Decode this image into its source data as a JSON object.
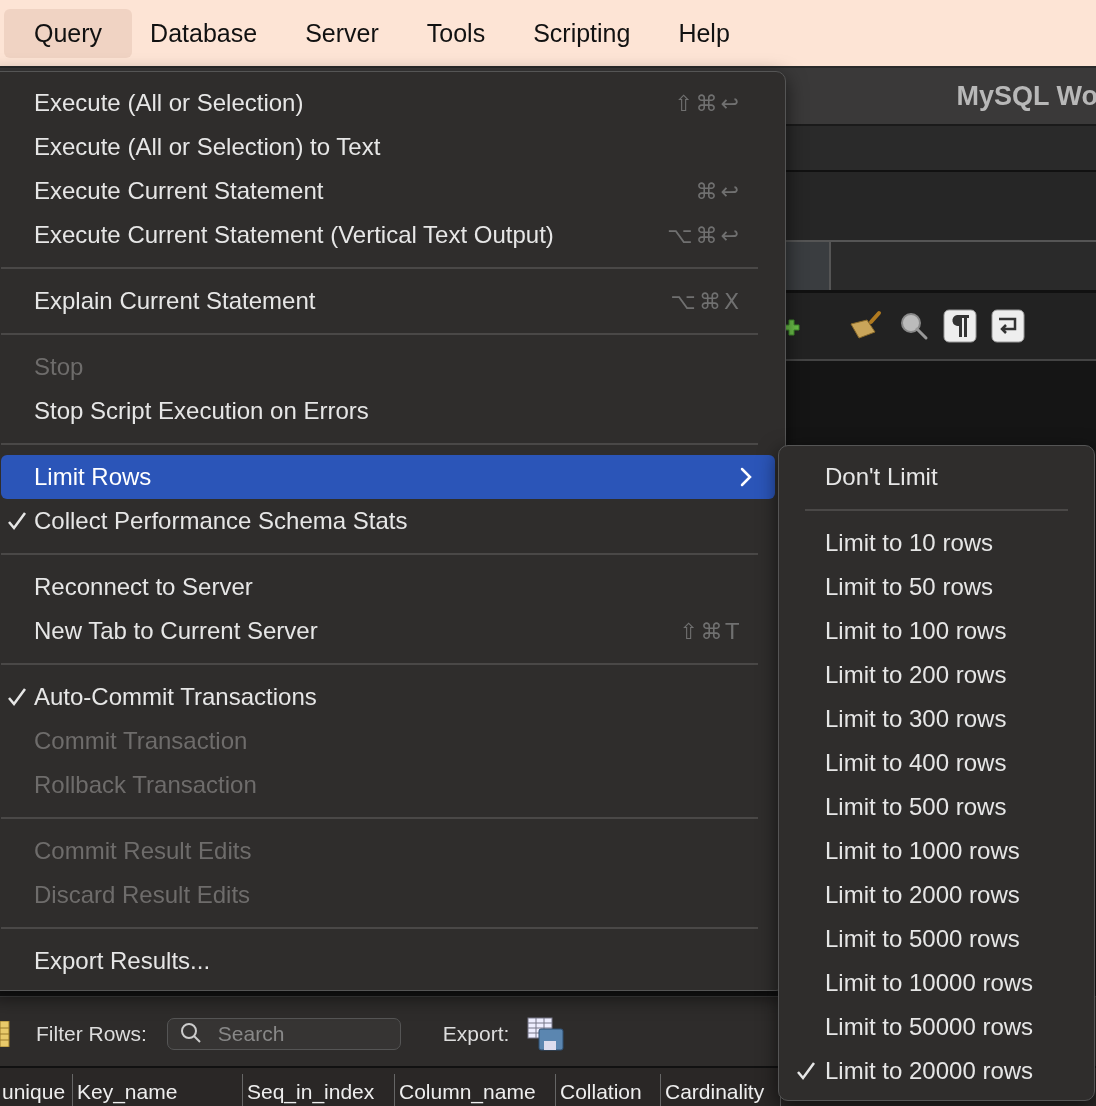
{
  "menubar": [
    {
      "label": "Query",
      "selected": true
    },
    {
      "label": "Database",
      "selected": false
    },
    {
      "label": "Server",
      "selected": false
    },
    {
      "label": "Tools",
      "selected": false
    },
    {
      "label": "Scripting",
      "selected": false
    },
    {
      "label": "Help",
      "selected": false
    }
  ],
  "window": {
    "title": "MySQL Wo"
  },
  "query_menu": {
    "items": [
      {
        "kind": "item",
        "label": "Execute (All or Selection)",
        "shortcut": "⇧⌘↩",
        "disabled": false,
        "checked": false,
        "selected": false
      },
      {
        "kind": "item",
        "label": "Execute (All or Selection) to Text",
        "disabled": false,
        "checked": false,
        "selected": false
      },
      {
        "kind": "item",
        "label": "Execute Current Statement",
        "shortcut": "⌘↩",
        "disabled": false,
        "checked": false,
        "selected": false
      },
      {
        "kind": "item",
        "label": "Execute Current Statement (Vertical Text Output)",
        "shortcut": "⌥⌘↩",
        "disabled": false,
        "checked": false,
        "selected": false
      },
      {
        "kind": "separator"
      },
      {
        "kind": "item",
        "label": "Explain Current Statement",
        "shortcut": "⌥⌘X",
        "disabled": false,
        "checked": false,
        "selected": false
      },
      {
        "kind": "separator"
      },
      {
        "kind": "item",
        "label": "Stop",
        "disabled": true,
        "checked": false,
        "selected": false
      },
      {
        "kind": "item",
        "label": "Stop Script Execution on Errors",
        "disabled": false,
        "checked": false,
        "selected": false
      },
      {
        "kind": "separator"
      },
      {
        "kind": "submenu",
        "label": "Limit Rows",
        "disabled": false,
        "checked": false,
        "selected": true
      },
      {
        "kind": "item",
        "label": "Collect Performance Schema Stats",
        "disabled": false,
        "checked": true,
        "selected": false
      },
      {
        "kind": "separator"
      },
      {
        "kind": "item",
        "label": "Reconnect to Server",
        "disabled": false,
        "checked": false,
        "selected": false
      },
      {
        "kind": "item",
        "label": "New Tab to Current Server",
        "shortcut": "⇧⌘T",
        "disabled": false,
        "checked": false,
        "selected": false
      },
      {
        "kind": "separator"
      },
      {
        "kind": "item",
        "label": "Auto-Commit Transactions",
        "disabled": false,
        "checked": true,
        "selected": false
      },
      {
        "kind": "item",
        "label": "Commit Transaction",
        "disabled": true,
        "checked": false,
        "selected": false
      },
      {
        "kind": "item",
        "label": "Rollback Transaction",
        "disabled": true,
        "checked": false,
        "selected": false
      },
      {
        "kind": "separator"
      },
      {
        "kind": "item",
        "label": "Commit Result Edits",
        "disabled": true,
        "checked": false,
        "selected": false
      },
      {
        "kind": "item",
        "label": "Discard Result Edits",
        "disabled": true,
        "checked": false,
        "selected": false
      },
      {
        "kind": "separator"
      },
      {
        "kind": "item",
        "label": "Export Results...",
        "disabled": false,
        "checked": false,
        "selected": false
      }
    ]
  },
  "limit_rows_submenu": {
    "items": [
      {
        "kind": "item",
        "label": "Don't Limit",
        "checked": false
      },
      {
        "kind": "separator"
      },
      {
        "kind": "item",
        "label": "Limit to 10 rows",
        "checked": false
      },
      {
        "kind": "item",
        "label": "Limit to 50 rows",
        "checked": false
      },
      {
        "kind": "item",
        "label": "Limit to 100 rows",
        "checked": false
      },
      {
        "kind": "item",
        "label": "Limit to 200 rows",
        "checked": false
      },
      {
        "kind": "item",
        "label": "Limit to 300 rows",
        "checked": false
      },
      {
        "kind": "item",
        "label": "Limit to 400 rows",
        "checked": false
      },
      {
        "kind": "item",
        "label": "Limit to 500 rows",
        "checked": false
      },
      {
        "kind": "item",
        "label": "Limit to 1000 rows",
        "checked": false
      },
      {
        "kind": "item",
        "label": "Limit to 2000 rows",
        "checked": false
      },
      {
        "kind": "item",
        "label": "Limit to 5000 rows",
        "checked": false
      },
      {
        "kind": "item",
        "label": "Limit to 10000 rows",
        "checked": false
      },
      {
        "kind": "item",
        "label": "Limit to 50000 rows",
        "checked": false
      },
      {
        "kind": "item",
        "label": "Limit to 20000 rows",
        "checked": true
      }
    ]
  },
  "filter_bar": {
    "label": "Filter Rows:",
    "search": {
      "placeholder": "Search"
    },
    "export_label": "Export:"
  },
  "result_grid": {
    "columns": [
      "unique",
      "Key_name",
      "Seq_in_index",
      "Column_name",
      "Collation",
      "Cardinality"
    ]
  }
}
